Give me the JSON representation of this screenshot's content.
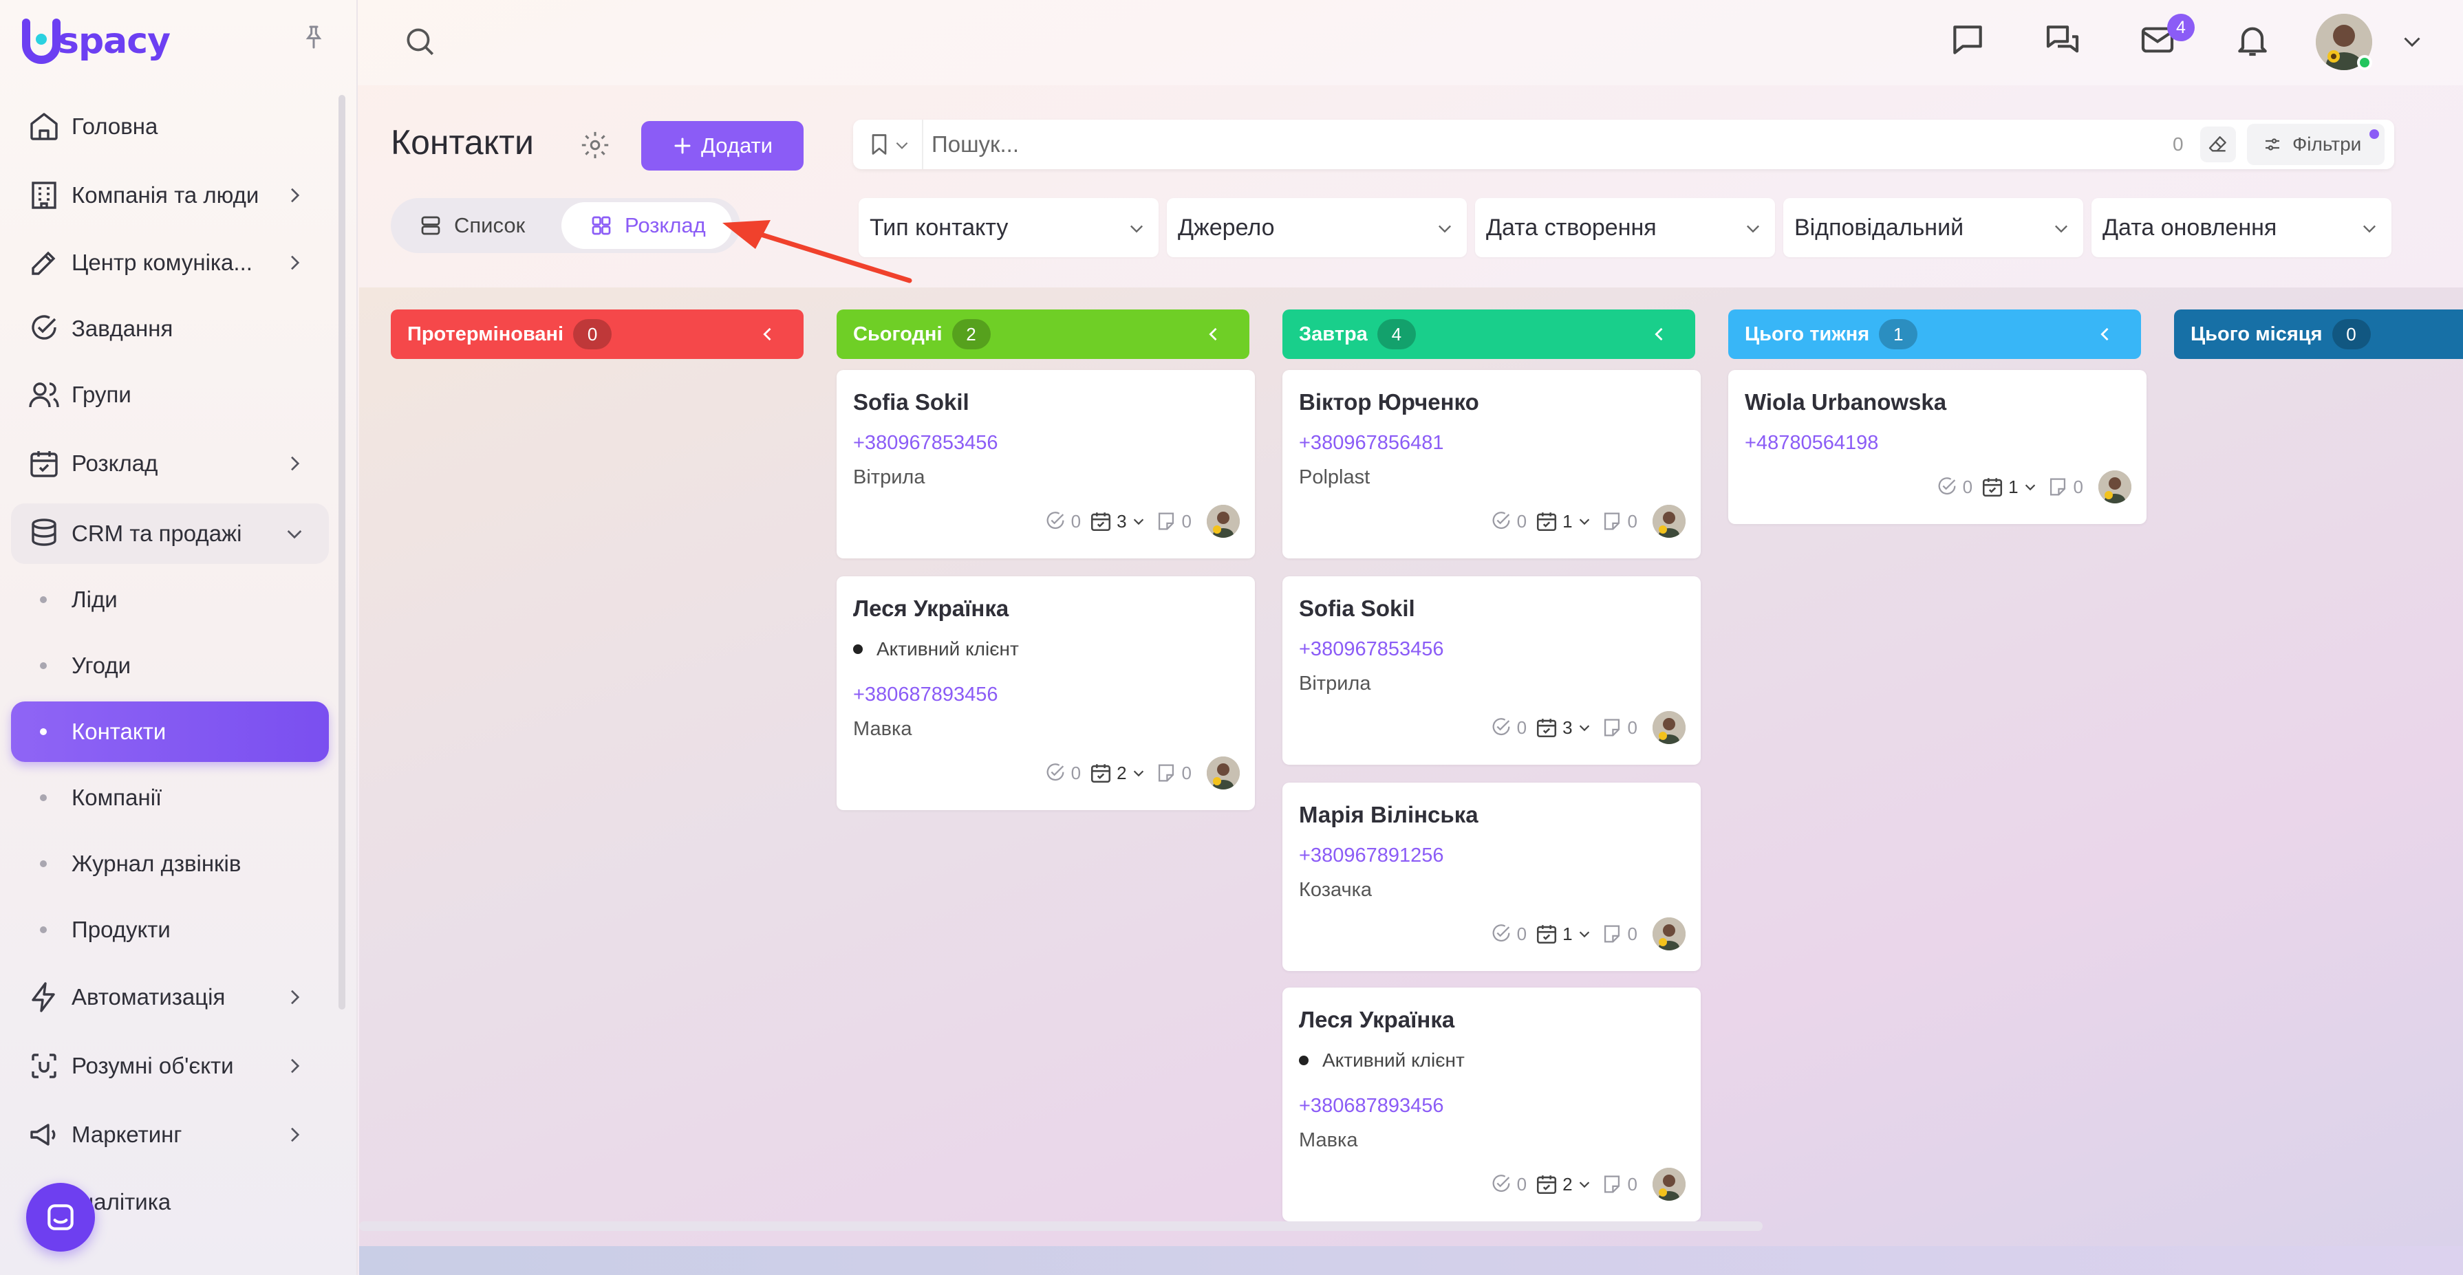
{
  "app": {
    "logo_text": "spacy",
    "brand_color": "#6c3ff2"
  },
  "sidebar": {
    "items": [
      {
        "label": "Головна",
        "icon": "home-icon"
      },
      {
        "label": "Компанія та люди",
        "icon": "building-icon"
      },
      {
        "label": "Центр комуніка...",
        "icon": "edit-icon"
      },
      {
        "label": "Завдання",
        "icon": "check-circle-icon"
      },
      {
        "label": "Групи",
        "icon": "users-icon"
      },
      {
        "label": "Розклад",
        "icon": "calendar-icon"
      },
      {
        "label": "CRM та продажі",
        "icon": "database-icon"
      }
    ],
    "crm_sub": [
      "Ліди",
      "Угоди",
      "Контакти",
      "Компанії",
      "Журнал дзвінків",
      "Продукти"
    ],
    "items_after": [
      {
        "label": "Автоматизація",
        "icon": "bolt-icon"
      },
      {
        "label": "Розумні об'єкти",
        "icon": "scan-icon"
      },
      {
        "label": "Маркетинг",
        "icon": "megaphone-icon"
      },
      {
        "label": "налітика",
        "icon": "chart-icon"
      }
    ]
  },
  "topbar": {
    "mail_badge": "4"
  },
  "header": {
    "title": "Контакти",
    "add_label": "Додати",
    "search_placeholder": "Пошук...",
    "search_count": "0",
    "filters_label": "Фільтри",
    "view_list": "Список",
    "view_schedule": "Розклад"
  },
  "filters": [
    "Тип контакту",
    "Джерело",
    "Дата створення",
    "Відповідальний",
    "Дата оновлення"
  ],
  "columns": [
    {
      "title": "Протерміновані",
      "count": "0",
      "color": "#f5484a"
    },
    {
      "title": "Сьогодні",
      "count": "2",
      "color": "#6fcf26"
    },
    {
      "title": "Завтра",
      "count": "4",
      "color": "#19cf8b"
    },
    {
      "title": "Цього тижня",
      "count": "1",
      "color": "#38b6f7"
    },
    {
      "title": "Цього місяця",
      "count": "0",
      "color": "#1770a6"
    }
  ],
  "cards": {
    "today": [
      {
        "name": "Sofia Sokil",
        "phone": "+380967853456",
        "company": "Вітрила",
        "tasks": "0",
        "events": "3",
        "notes": "0"
      },
      {
        "name": "Леся Українка",
        "status": "Активний клієнт",
        "phone": "+380687893456",
        "company": "Мавка",
        "tasks": "0",
        "events": "2",
        "notes": "0"
      }
    ],
    "tomorrow": [
      {
        "name": "Віктор Юрченко",
        "phone": "+380967856481",
        "company": "Polplast",
        "tasks": "0",
        "events": "1",
        "notes": "0"
      },
      {
        "name": "Sofia Sokil",
        "phone": "+380967853456",
        "company": "Вітрила",
        "tasks": "0",
        "events": "3",
        "notes": "0"
      },
      {
        "name": "Марія Вілінська",
        "phone": "+380967891256",
        "company": "Козачка",
        "tasks": "0",
        "events": "1",
        "notes": "0"
      },
      {
        "name": "Леся Українка",
        "status": "Активний клієнт",
        "phone": "+380687893456",
        "company": "Мавка",
        "tasks": "0",
        "events": "2",
        "notes": "0"
      }
    ],
    "week": [
      {
        "name": "Wiola Urbanowska",
        "phone": "+48780564198",
        "tasks": "0",
        "events": "1",
        "notes": "0"
      }
    ]
  }
}
